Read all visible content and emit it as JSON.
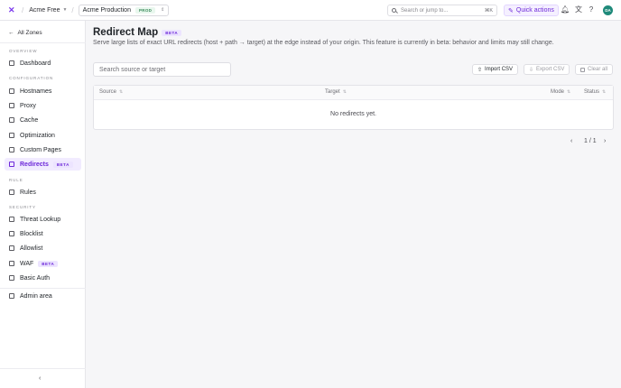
{
  "topbar": {
    "org_name": "Acme Free",
    "zone_name": "Acme Production",
    "zone_badge": "PROD",
    "search_placeholder": "Search or jump to...",
    "search_shortcut": "⌘K",
    "quick_actions_label": "Quick actions",
    "avatar_initials": "DA"
  },
  "sidebar": {
    "back_label": "All Zones",
    "sections": {
      "overview": "OVERVIEW",
      "configuration": "CONFIGURATION",
      "rule": "RULE",
      "security": "SECURITY"
    },
    "items": {
      "dashboard": "Dashboard",
      "hostnames": "Hostnames",
      "proxy": "Proxy",
      "cache": "Cache",
      "optimization": "Optimization",
      "custom_pages": "Custom Pages",
      "redirects": "Redirects",
      "redirects_badge": "BETA",
      "rules": "Rules",
      "threat_lookup": "Threat Lookup",
      "blocklist": "Blocklist",
      "allowlist": "Allowlist",
      "waf": "WAF",
      "waf_badge": "BETA",
      "basic_auth": "Basic Auth",
      "admin_area": "Admin area"
    },
    "collapse_glyph": "‹"
  },
  "main": {
    "title": "Redirect Map",
    "title_badge": "BETA",
    "description": "Serve large lists of exact URL redirects (host + path → target) at the edge instead of your origin. This feature is currently in beta: behavior and limits may still change.",
    "filter_placeholder": "Search source or target",
    "buttons": {
      "import": "Import CSV",
      "export": "Export CSV",
      "clear": "Clear all"
    },
    "table": {
      "columns": [
        "Source",
        "Target",
        "Mode",
        "Status"
      ],
      "empty_text": "No redirects yet."
    },
    "pagination": {
      "page_text": "1 / 1",
      "prev_glyph": "‹",
      "next_glyph": "›"
    }
  },
  "colors": {
    "accent": "#6d28d9",
    "accent_bg": "#f1ebff",
    "avatar": "#1f8a7a",
    "prod_badge": "#3a8a5a"
  }
}
